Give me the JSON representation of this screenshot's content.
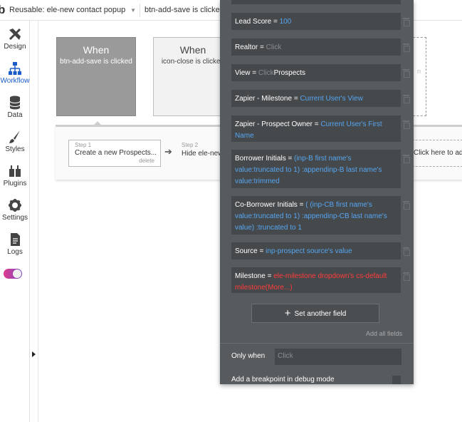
{
  "topbar": {
    "logo": "b",
    "page_select": "Reusable: ele-new contact popup",
    "event_select": "btn-add-save is clicked"
  },
  "sidebar": {
    "items": [
      {
        "label": "Design",
        "icon": "design-icon"
      },
      {
        "label": "Workflow",
        "icon": "workflow-icon"
      },
      {
        "label": "Data",
        "icon": "data-icon"
      },
      {
        "label": "Styles",
        "icon": "styles-icon"
      },
      {
        "label": "Plugins",
        "icon": "plugins-icon"
      },
      {
        "label": "Settings",
        "icon": "settings-icon"
      },
      {
        "label": "Logs",
        "icon": "logs-icon"
      }
    ],
    "active_color": "#1a5cc8"
  },
  "canvas": {
    "events": [
      {
        "when": "When",
        "condition": "btn-add-save is clicked"
      },
      {
        "when": "When",
        "condition": "icon-close is clicked"
      }
    ],
    "event3_fragment": "n",
    "step1": {
      "number": "Step 1",
      "title": "Create a new Prospects...",
      "delete": "delete"
    },
    "step2": {
      "number": "Step 2",
      "title": "Hide ele-new"
    },
    "add_action": "Click here to add"
  },
  "panel": {
    "fields": [
      {
        "label": "Lead Score",
        "value": "100"
      },
      {
        "label": "Realtor",
        "value": "Click"
      },
      {
        "label": "View",
        "prefix": "Click",
        "value": "Prospects"
      },
      {
        "label": "Zapier - Milestone",
        "value": "Current User's View"
      },
      {
        "label": "Zapier - Prospect Owner",
        "value": "Current User's First Name"
      },
      {
        "label": "Borrower Initials",
        "value": "(inp-B first name's value:truncated to 1) :appendinp-B last name's value:trimmed"
      },
      {
        "label": "Co-Borrower Initials",
        "value": "( (inp-CB first name's value:truncated to 1) :appendinp-CB last name's value) :truncated to 1"
      },
      {
        "label": "Source",
        "value": "inp-prospect source's value"
      },
      {
        "label": "Milestone",
        "value": "ele-milestone dropdown's cs-default milestone(More...)"
      }
    ],
    "set_another": "Set another field",
    "add_all": "Add all fields",
    "only_when_label": "Only when",
    "only_when_placeholder": "Click",
    "breakpoint_label": "Add a breakpoint in debug mode",
    "colors": {
      "value_blue": "#55a6f2",
      "error_red": "#ff3b3b",
      "panel_bg": "#585b5d"
    }
  }
}
